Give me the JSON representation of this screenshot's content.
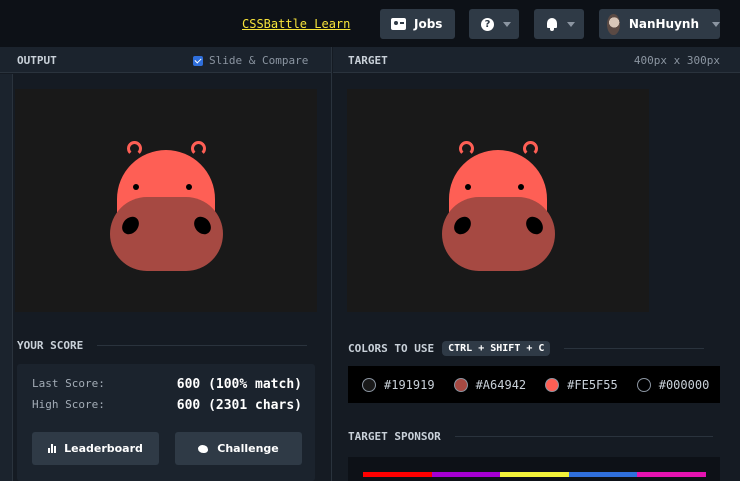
{
  "header": {
    "learn_link": "CSSBattle Learn",
    "jobs_label": "Jobs",
    "help_icon": "?",
    "username": "NanHuynh"
  },
  "output": {
    "title": "OUTPUT",
    "slide_compare_label": "Slide & Compare",
    "slide_compare_checked": true
  },
  "target": {
    "title": "TARGET",
    "dimensions": "400px x 300px"
  },
  "score": {
    "title": "YOUR SCORE",
    "last_label": "Last Score:",
    "last_value": "600 (100% match)",
    "high_label": "High Score:",
    "high_value": "600 (2301 chars)",
    "leaderboard_label": "Leaderboard",
    "challenge_label": "Challenge"
  },
  "colors": {
    "title": "COLORS TO USE",
    "shortcut": "CTRL + SHIFT + C",
    "items": [
      {
        "hex": "#191919",
        "label": "#191919"
      },
      {
        "hex": "#A64942",
        "label": "#A64942"
      },
      {
        "hex": "#FE5F55",
        "label": "#FE5F55"
      },
      {
        "hex": "#000000",
        "label": "#000000"
      }
    ]
  },
  "sponsor": {
    "title": "TARGET SPONSOR",
    "stripe_colors": [
      "#ff0000",
      "#a600d3",
      "#f2f23a",
      "#2f6fdc",
      "#e513b0"
    ]
  },
  "palette": {
    "background": "#191919",
    "snout": "#a64942",
    "head": "#fe5f55",
    "features": "#000000"
  }
}
